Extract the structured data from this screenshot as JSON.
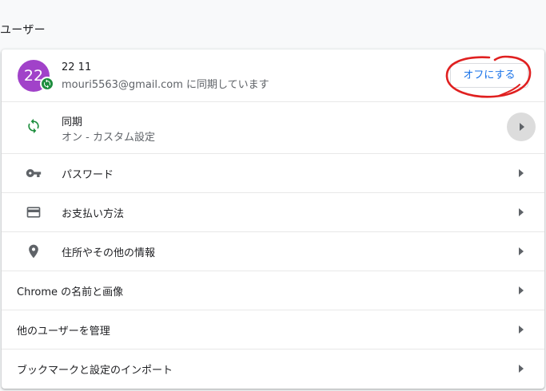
{
  "section": {
    "title": "ユーザー"
  },
  "account": {
    "avatar_initials": "22",
    "name": "22 11",
    "email_status": "mouri5563@gmail.com に同期しています",
    "off_button_label": "オフにする"
  },
  "rows": {
    "sync": {
      "title": "同期",
      "subtitle": "オン - カスタム設定"
    },
    "passwords": {
      "title": "パスワード"
    },
    "payments": {
      "title": "お支払い方法"
    },
    "addresses": {
      "title": "住所やその他の情報"
    },
    "chrome_name": {
      "title": "Chrome の名前と画像"
    },
    "manage_users": {
      "title": "他のユーザーを管理"
    },
    "import": {
      "title": "ブックマークと設定のインポート"
    }
  },
  "colors": {
    "avatar": "#a142c9",
    "sync_icon": "#1e8e3e",
    "button_text": "#1a73e8",
    "annotation": "#e02020"
  },
  "icons": {
    "sync": "sync-icon",
    "passwords": "key-icon",
    "payments": "credit-card-icon",
    "addresses": "location-pin-icon",
    "arrow": "arrow-right-icon"
  }
}
